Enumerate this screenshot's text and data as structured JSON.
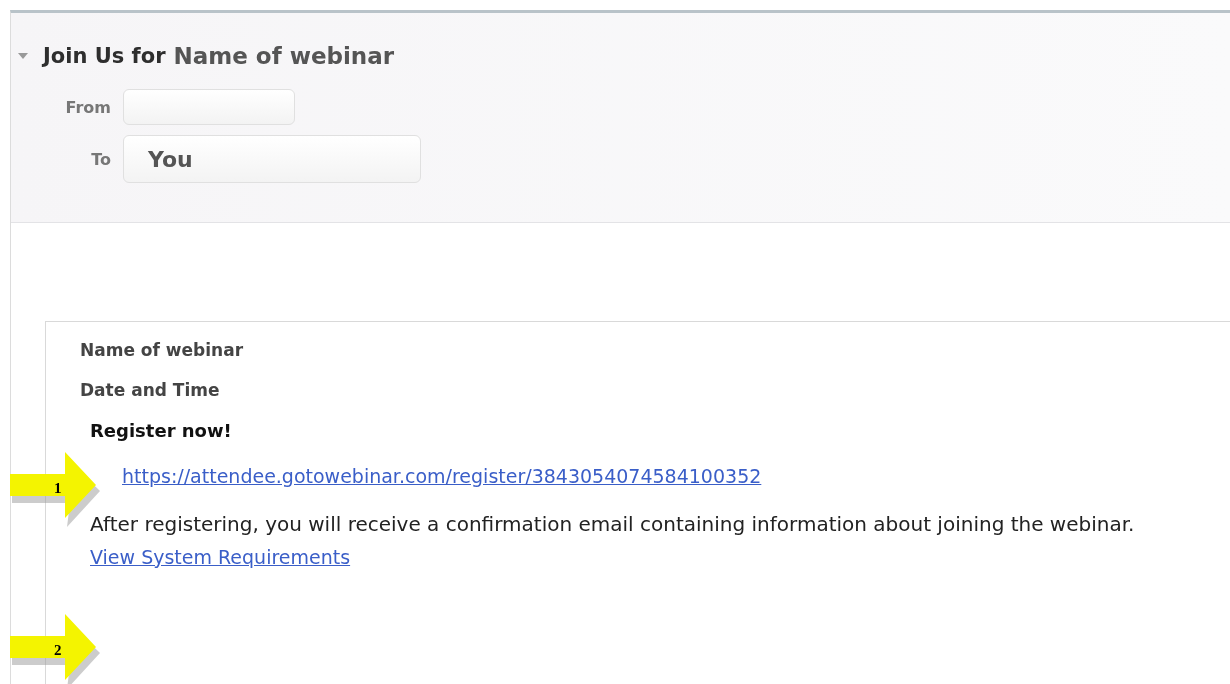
{
  "header": {
    "expanded": true,
    "title_prefix": "Join Us for",
    "title": "Name of webinar",
    "from": {
      "label": "From"
    },
    "to": {
      "label": "To",
      "value": "You"
    }
  },
  "message": {
    "webinar_name": "Name of webinar",
    "date_time": "Date and Time",
    "register_heading": "Register now!",
    "register_link": "https://attendee.gotowebinar.com/register/3843054074584100352",
    "note": "After registering, you will receive a confirmation email containing information about joining the webinar.",
    "requirements_link": "View System Requirements"
  },
  "callouts": [
    {
      "number": "1"
    },
    {
      "number": "2"
    }
  ]
}
